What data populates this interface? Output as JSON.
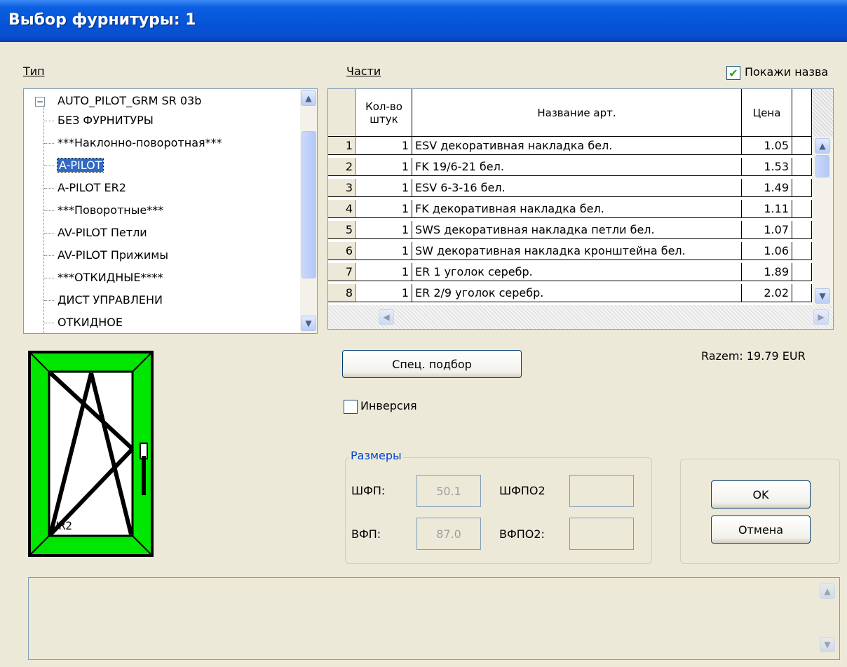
{
  "window": {
    "title": "Выбор фурнитуры: 1"
  },
  "labels": {
    "type": "Тип",
    "parts": "Части",
    "show_names": "Покажи назва",
    "spec_button": "Спец. подбор",
    "inversion": "Инверсия",
    "total": "Razem:  19.79 EUR",
    "sizes_group": "Размеры",
    "ok": "OK",
    "cancel": "Отмена"
  },
  "show_names_checked": true,
  "inversion_checked": false,
  "tree": {
    "root": "AUTO_PILOT_GRM SR  03b",
    "root_toggle": "⊟",
    "items": [
      "БЕЗ ФУРНИТУРЫ",
      "***Наклонно-поворотная***",
      "A-PILOT",
      "A-PILOT ER2",
      "***Поворотные***",
      "AV-PILOT Петли",
      "AV-PILOT Прижимы",
      "***ОТКИДНЫЕ****",
      "ДИСТ УПРАВЛЕНИ",
      "ОТКИДНОЕ"
    ],
    "selected_index": 2
  },
  "table": {
    "columns": [
      "",
      "Кол-во штук",
      "Название арт.",
      "Цена"
    ],
    "rows": [
      {
        "n": "1",
        "qty": "1",
        "name": "ESV декоративная накладка бел.",
        "price": "1.05"
      },
      {
        "n": "2",
        "qty": "1",
        "name": "FK 19/6-21 бел.",
        "price": "1.53"
      },
      {
        "n": "3",
        "qty": "1",
        "name": "ESV 6-3-16 бел.",
        "price": "1.49"
      },
      {
        "n": "4",
        "qty": "1",
        "name": "FK декоративная накладка бел.",
        "price": "1.11"
      },
      {
        "n": "5",
        "qty": "1",
        "name": "SWS декоративная накладка петли бел.",
        "price": "1.07"
      },
      {
        "n": "6",
        "qty": "1",
        "name": "SW декоративная накладка кронштейна бел.",
        "price": "1.06"
      },
      {
        "n": "7",
        "qty": "1",
        "name": "ER 1 уголок серебр.",
        "price": "1.89"
      },
      {
        "n": "8",
        "qty": "1",
        "name": "ER 2/9 уголок серебр.",
        "price": "2.02"
      }
    ]
  },
  "sizes": {
    "w_label": "ШФП:",
    "w_value": "50.1",
    "h_label": "ВФП:",
    "h_value": "87.0",
    "w2_label": "ШФПО2",
    "w2_value": "",
    "h2_label": "ВФПО2:",
    "h2_value": ""
  },
  "window_preview": {
    "label": "UR2",
    "frame_color": "#00e600"
  },
  "icons": {
    "check": "✔",
    "up": "▲",
    "down": "▼",
    "left": "◀",
    "right": "▶"
  }
}
